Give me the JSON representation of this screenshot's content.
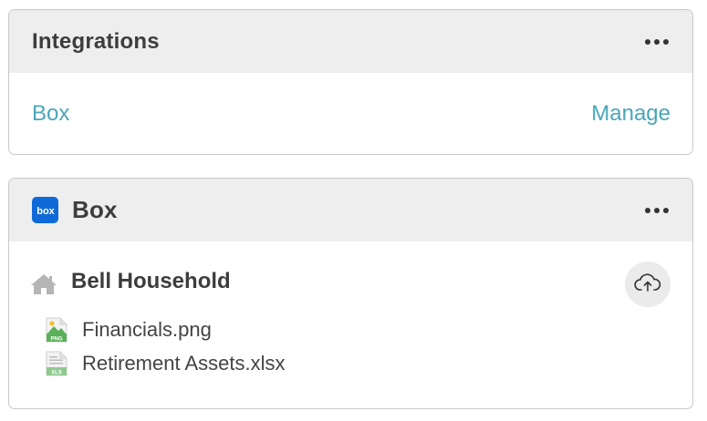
{
  "integrations_card": {
    "title": "Integrations",
    "more_icon": "more-horizontal-icon",
    "rows": [
      {
        "name": "Box",
        "action": "Manage"
      }
    ]
  },
  "box_card": {
    "title": "Box",
    "logo_text": "box",
    "logo_color": "#0f6ad8",
    "more_icon": "more-horizontal-icon",
    "folder": {
      "icon": "home-icon",
      "name": "Bell Household",
      "upload_icon": "cloud-upload-icon"
    },
    "files": [
      {
        "name": "Financials.png",
        "type_label": "PNG",
        "icon": "image-file-icon"
      },
      {
        "name": "Retirement Assets.xlsx",
        "type_label": "XLS",
        "icon": "spreadsheet-file-icon"
      }
    ]
  },
  "colors": {
    "link": "#4aa6b8",
    "header_bg": "#eeeeee",
    "text": "#3d3d3d",
    "file_green": "#5bb05b"
  }
}
